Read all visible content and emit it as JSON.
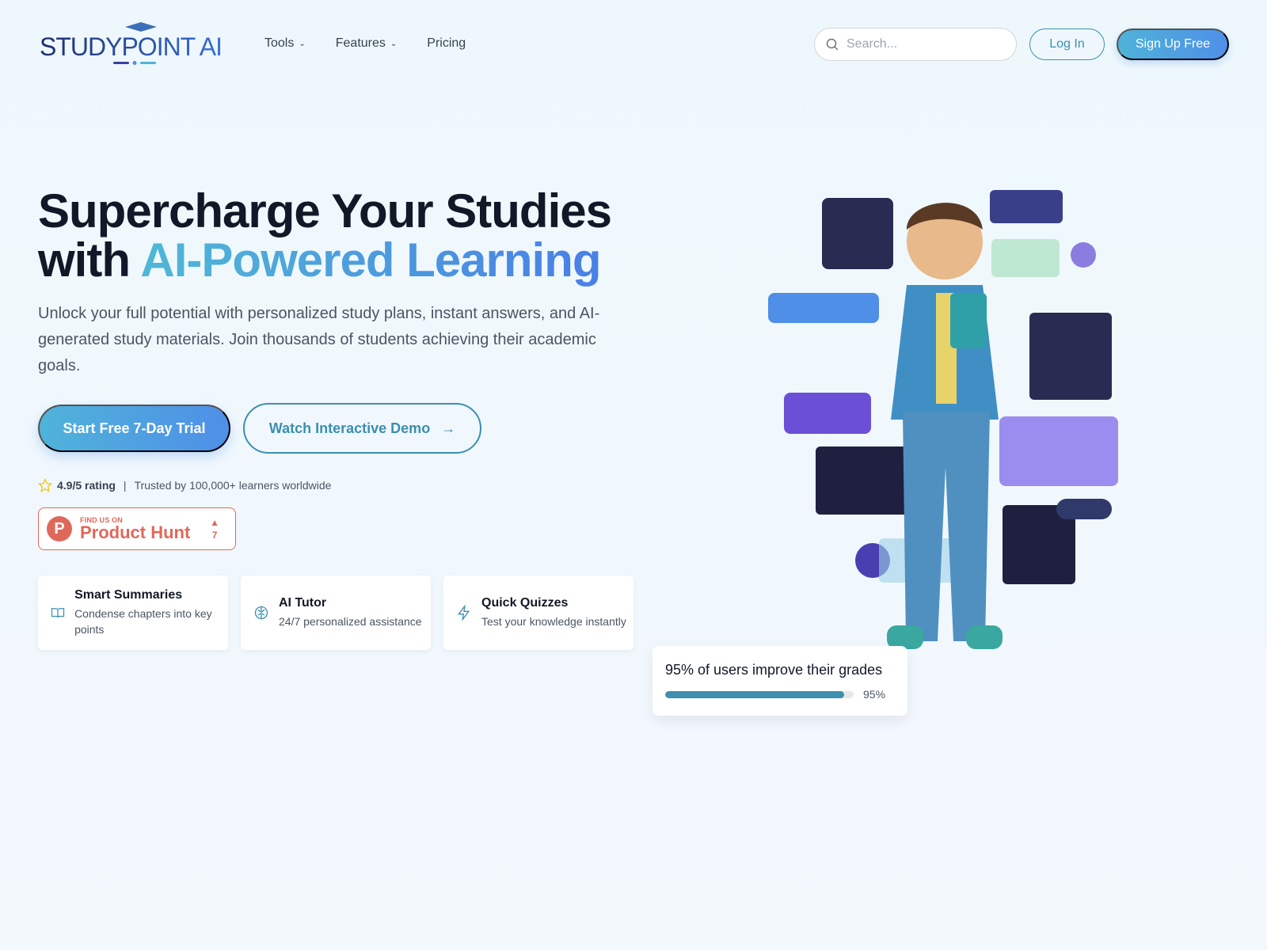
{
  "brand": {
    "name": "STUDYPOINT AI"
  },
  "nav": {
    "items": [
      {
        "label": "Tools",
        "dropdown": true
      },
      {
        "label": "Features",
        "dropdown": true
      },
      {
        "label": "Pricing",
        "dropdown": false
      }
    ],
    "search_placeholder": "Search...",
    "login": "Log In",
    "signup": "Sign Up Free"
  },
  "hero": {
    "title_line1": "Supercharge Your Studies",
    "title_with": "with ",
    "title_highlight": "AI-Powered Learning",
    "subtitle": "Unlock your full potential with personalized study plans, instant answers, and AI-generated study materials. Join thousands of students achieving their academic goals.",
    "cta_primary": "Start Free 7-Day Trial",
    "cta_secondary": "Watch Interactive Demo",
    "rating": "4.9/5 rating",
    "separator": "|",
    "trusted": "Trusted by 100,000+ learners worldwide"
  },
  "product_hunt": {
    "small": "FIND US ON",
    "name": "Product Hunt",
    "letter": "P",
    "votes": "7"
  },
  "features": [
    {
      "icon": "book-open-icon",
      "title": "Smart Summaries",
      "desc": "Condense chapters into key points"
    },
    {
      "icon": "brain-icon",
      "title": "AI Tutor",
      "desc": "24/7 personalized assistance"
    },
    {
      "icon": "lightning-icon",
      "title": "Quick Quizzes",
      "desc": "Test your knowledge instantly"
    }
  ],
  "stat": {
    "text": "95% of users improve their grades",
    "percent": 95,
    "label": "95%"
  },
  "colors": {
    "accent": "#3b8fb0",
    "gradient_start": "#4fb3d9",
    "gradient_end": "#4f8fe8",
    "product_hunt": "#e0685a",
    "star": "#f5c518"
  }
}
